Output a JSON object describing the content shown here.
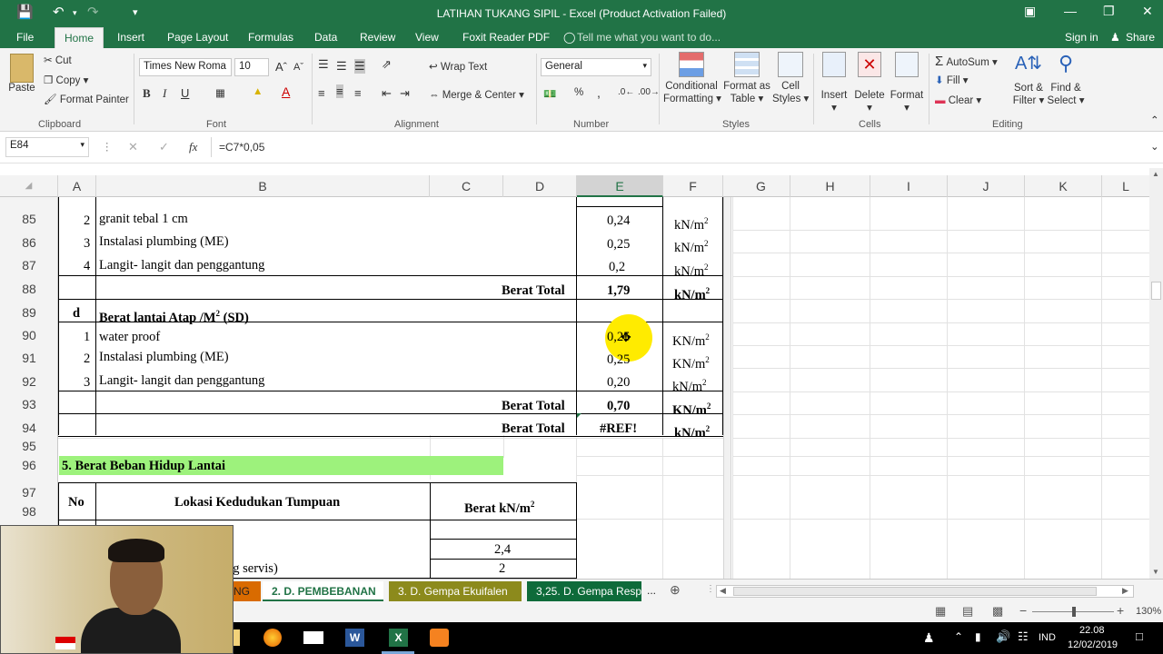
{
  "title": "LATIHAN TUKANG SIPIL - Excel (Product Activation Failed)",
  "tabs": [
    "File",
    "Home",
    "Insert",
    "Page Layout",
    "Formulas",
    "Data",
    "Review",
    "View",
    "Foxit Reader PDF"
  ],
  "tell_me": "Tell me what you want to do...",
  "sign_in": "Sign in",
  "share": "Share",
  "clipboard": {
    "paste": "Paste",
    "cut": "Cut",
    "copy": "Copy",
    "format_painter": "Format Painter",
    "label": "Clipboard"
  },
  "font": {
    "name": "Times New Roma",
    "size": "10",
    "bold": "B",
    "italic": "I",
    "underline": "U",
    "label": "Font"
  },
  "alignment": {
    "wrap": "Wrap Text",
    "merge": "Merge & Center",
    "label": "Alignment"
  },
  "number": {
    "format": "General",
    "percent": "%",
    "comma": ",",
    "label": "Number"
  },
  "styles": {
    "cond": "Conditional",
    "cond2": "Formatting",
    "fmt_table": "Format as",
    "fmt_table2": "Table",
    "cell_styles": "Cell",
    "cell_styles2": "Styles",
    "label": "Styles"
  },
  "cells": {
    "insert": "Insert",
    "delete": "Delete",
    "format": "Format",
    "label": "Cells"
  },
  "editing": {
    "autosum": "AutoSum",
    "fill": "Fill",
    "clear": "Clear",
    "sort": "Sort &",
    "sort2": "Filter",
    "find": "Find &",
    "find2": "Select",
    "label": "Editing"
  },
  "name_box": "E84",
  "formula": "=C7*0,05",
  "fx": "fx",
  "columns": [
    "A",
    "B",
    "C",
    "D",
    "E",
    "F",
    "G",
    "H",
    "I",
    "J",
    "K",
    "L"
  ],
  "rows": [
    "85",
    "86",
    "87",
    "88",
    "89",
    "90",
    "91",
    "92",
    "93",
    "94",
    "95",
    "96",
    "97",
    "98"
  ],
  "cells_data": {
    "r85a": "2",
    "r85b": "granit tebal 1 cm",
    "r85e": "0,24",
    "r85f": "kN/m",
    "r86a": "3",
    "r86b": "Instalasi plumbing (ME)",
    "r86e": "0,25",
    "r86f": "kN/m",
    "r87a": "4",
    "r87b": "Langit- langit dan penggantung",
    "r87e": "0,2",
    "r87f": "kN/m",
    "r88d": "Berat Total",
    "r88e": "1,79",
    "r88f": "kN/m",
    "r89a": "d",
    "r89b": "Berat lantai Atap /M",
    "r89b2": "(SD)",
    "r90a": "1",
    "r90b": "water proof",
    "r90e": "0,25",
    "r90f": "KN/m",
    "r91a": "2",
    "r91b": "Instalasi plumbing (ME)",
    "r91e": "0,25",
    "r91f": "KN/m",
    "r92a": "3",
    "r92b": "Langit- langit dan penggantung",
    "r92e": "0,20",
    "r92f": "kN/m",
    "r93d": "Berat Total",
    "r93e": "0,70",
    "r93f": "KN/m",
    "r94d": "Berat Total",
    "r94e": "#REF!",
    "r94f": "kN/m",
    "r96": "5. Berat Beban Hidup Lantai",
    "r97a": "No",
    "r97b": "Lokasi Kedudukan Tumpuan",
    "r97c": "Berat kN/m",
    "r99c": "2,4",
    "r100b": "ng servis)",
    "r100c": "2",
    "sup": "2"
  },
  "sheets": [
    "NG",
    "2. D. PEMBEBANAN",
    "3. D. Gempa Ekuifalen",
    "3,25. D. Gempa Resp"
  ],
  "zoom": "130%",
  "clock_time": "22.08",
  "clock_date": "12/02/2019",
  "lang": "IND",
  "colors": {
    "excel_green": "#217346",
    "highlight": "#9df27c",
    "cursor": "#ffeb00"
  }
}
